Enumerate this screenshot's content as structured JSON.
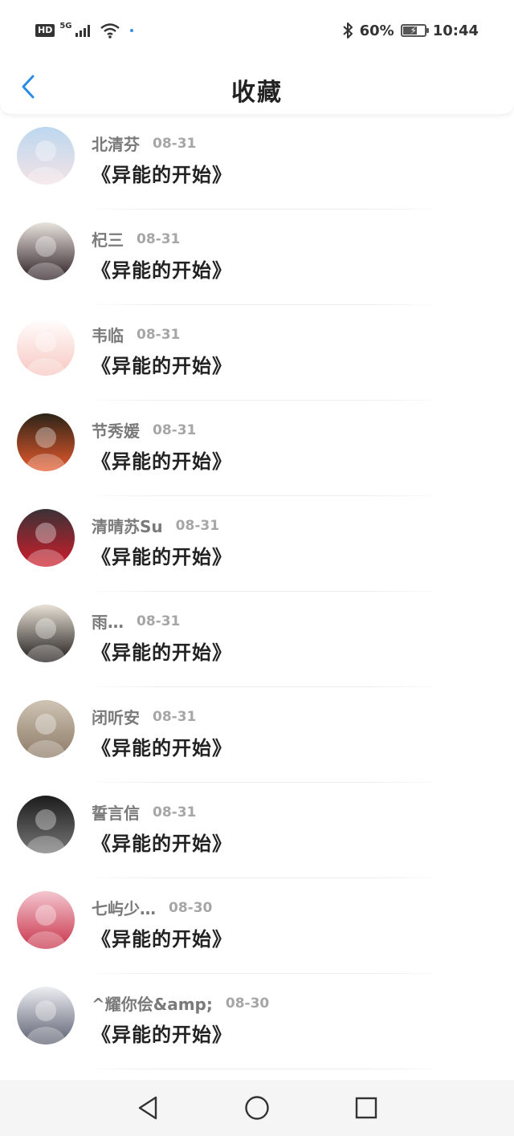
{
  "status_bar": {
    "hd": "HD",
    "network": "5G",
    "battery_text": "60%",
    "battery_level": 0.6,
    "time": "10:44",
    "icons": [
      "signal-icon",
      "wifi-icon",
      "bluetooth-icon",
      "battery-icon"
    ]
  },
  "header": {
    "title": "收藏",
    "back_icon": "chevron-left-icon",
    "accent_color": "#2a8ce6"
  },
  "favorites": [
    {
      "user": "北清芬",
      "date": "08-31",
      "title": "《异能的开始》",
      "avatar_colors": [
        "#bcd8ef",
        "#f3e2e6"
      ]
    },
    {
      "user": "杞三",
      "date": "08-31",
      "title": "《异能的开始》",
      "avatar_colors": [
        "#e9e4de",
        "#2a1c22"
      ]
    },
    {
      "user": "韦临",
      "date": "08-31",
      "title": "《异能的开始》",
      "avatar_colors": [
        "#ffffff",
        "#f7c7c0"
      ]
    },
    {
      "user": "节秀媛",
      "date": "08-31",
      "title": "《异能的开始》",
      "avatar_colors": [
        "#2c2418",
        "#e85a2c"
      ]
    },
    {
      "user": "清晴苏Su",
      "date": "08-31",
      "title": "《异能的开始》",
      "avatar_colors": [
        "#3a3236",
        "#d11d2b"
      ]
    },
    {
      "user": "雨…",
      "date": "08-31",
      "title": "《异能的开始》",
      "avatar_colors": [
        "#e8e1d6",
        "#1e1a19"
      ]
    },
    {
      "user": "闭听安",
      "date": "08-31",
      "title": "《异能的开始》",
      "avatar_colors": [
        "#cfc4b4",
        "#8c7a66"
      ]
    },
    {
      "user": "誓言信",
      "date": "08-31",
      "title": "《异能的开始》",
      "avatar_colors": [
        "#1c1c1c",
        "#777777"
      ]
    },
    {
      "user": "七屿少…",
      "date": "08-30",
      "title": "《异能的开始》",
      "avatar_colors": [
        "#f3c6cf",
        "#c9334a"
      ]
    },
    {
      "user": "^耀你侩&amp;",
      "date": "08-30",
      "title": "《异能的开始》",
      "avatar_colors": [
        "#eceef2",
        "#5c6070"
      ]
    }
  ],
  "nav_bar": {
    "back_icon": "triangle-back-icon",
    "home_icon": "circle-home-icon",
    "recents_icon": "square-recents-icon"
  }
}
